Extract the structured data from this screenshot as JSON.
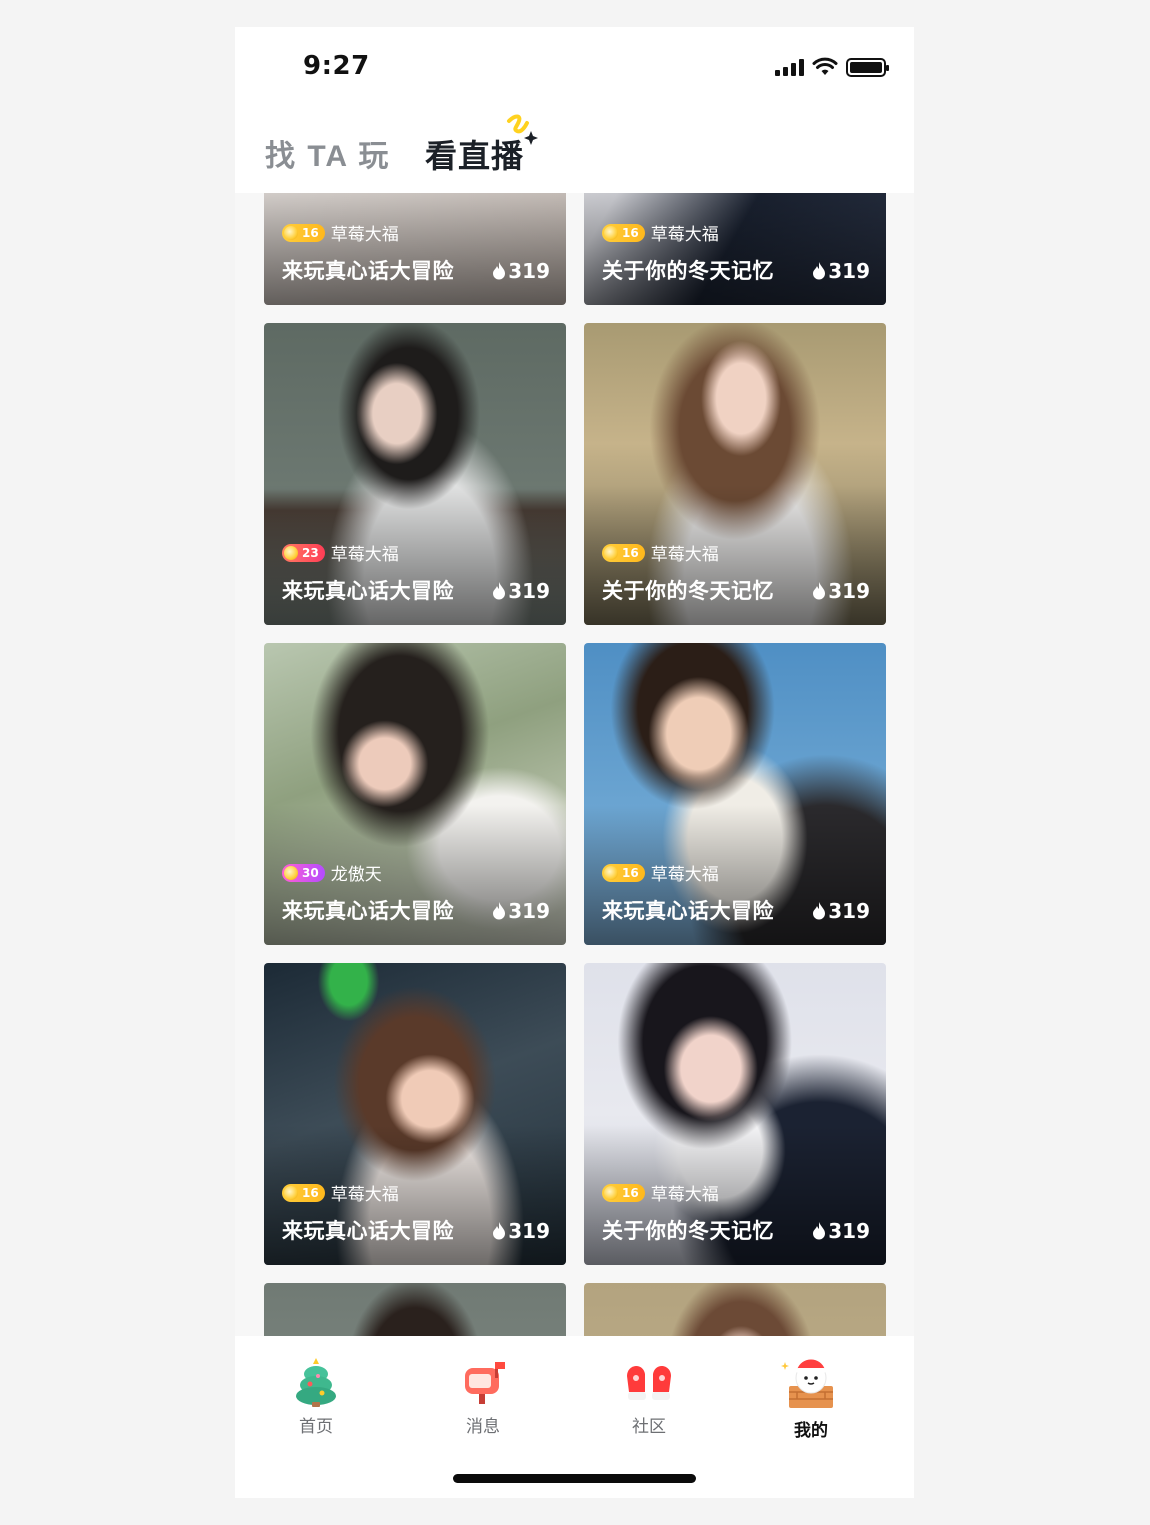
{
  "status_bar": {
    "time": "9:27"
  },
  "header": {
    "tabs": [
      {
        "label": "找 TA 玩",
        "active": false
      },
      {
        "label": "看直播",
        "active": true
      }
    ]
  },
  "cards": [
    {
      "level": "16",
      "level_color": "yellow",
      "name": "草莓大福",
      "title": "来玩真心话大冒险",
      "heat": "319"
    },
    {
      "level": "16",
      "level_color": "yellow",
      "name": "草莓大福",
      "title": "关于你的冬天记忆",
      "heat": "319"
    },
    {
      "level": "23",
      "level_color": "red",
      "name": "草莓大福",
      "title": "来玩真心话大冒险",
      "heat": "319"
    },
    {
      "level": "16",
      "level_color": "yellow",
      "name": "草莓大福",
      "title": "关于你的冬天记忆",
      "heat": "319"
    },
    {
      "level": "30",
      "level_color": "purple",
      "name": "龙傲天",
      "title": "来玩真心话大冒险",
      "heat": "319"
    },
    {
      "level": "16",
      "level_color": "yellow",
      "name": "草莓大福",
      "title": "来玩真心话大冒险",
      "heat": "319"
    },
    {
      "level": "16",
      "level_color": "yellow",
      "name": "草莓大福",
      "title": "来玩真心话大冒险",
      "heat": "319"
    },
    {
      "level": "16",
      "level_color": "yellow",
      "name": "草莓大福",
      "title": "关于你的冬天记忆",
      "heat": "319"
    }
  ],
  "bottom_nav": [
    {
      "label": "首页",
      "icon": "christmas-tree-icon",
      "active": false
    },
    {
      "label": "消息",
      "icon": "mailbox-icon",
      "active": false
    },
    {
      "label": "社区",
      "icon": "mittens-icon",
      "active": false
    },
    {
      "label": "我的",
      "icon": "snowman-chimney-icon",
      "active": true
    }
  ],
  "colors": {
    "active_tab": "#1b2027",
    "inactive_tab": "#8a8e93",
    "accent_yellow": "#ffd21f"
  }
}
